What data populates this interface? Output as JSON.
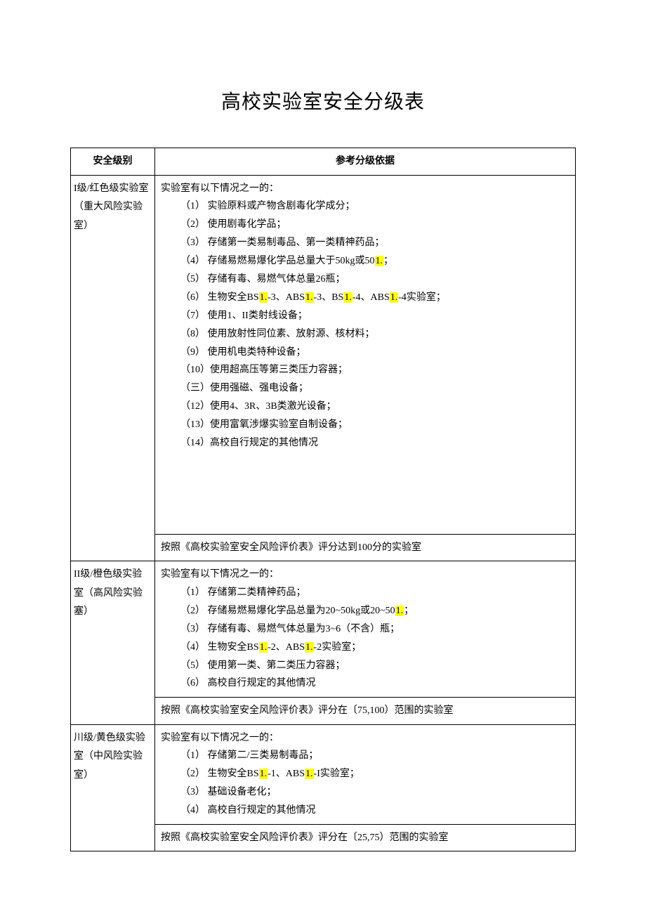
{
  "title": "高校实验室安全分级表",
  "headers": {
    "col1": "安全级别",
    "col2": "参考分级依据"
  },
  "levels": [
    {
      "name": "I级/红色级实验室（重大风险实验室）",
      "intro": "实验室有以下情况之一的：",
      "items": [
        "（1） 实验原料或产物含剧毒化学成分；",
        "（2） 使用剧毒化学品；",
        "（3） 存储第一类易制毒品、第一类精神药品；",
        "（4） 存储易燃易爆化学品总量大于50kg或50|1.|；",
        "（5） 存储有毒、易燃气体总量26瓶；",
        "（6） 生物安全BS|1.|-3、ABS|1.|-3、BS|1.|-4、ABS|1.|-4实验室；",
        "（7） 使用1、II类射线设备；",
        "（8） 使用放射性同位素、放射源、核材料；",
        "（9） 使用机电类特种设备；",
        "（10）使用超高压等第三类压力容器；",
        "（三）使用强磁、强电设备；",
        "（12）使用4、3R、3B类激光设备；",
        "（13）使用富氧涉爆实验室自制设备；",
        "（14）高校自行规定的其他情况"
      ],
      "score": "按照《高校实验室安全风险评价表》评分达到100分的实验室",
      "has_spacer": true
    },
    {
      "name": "II级/橙色级实验室（高风险实验塞）",
      "intro": "实验室有以下情况之一的：",
      "items": [
        "（1） 存储第二类精神药品；",
        "（2） 存储易燃易爆化学品总量为20~50kg或20~50|1.|；",
        "（3） 存储有毒、易燃气体总量为3~6（不含）瓶；",
        "（4） 生物安全BS|1.|-2、ABS|1.|-2实验室；",
        "（5） 使用第一类、第二类压力容器；",
        "（6） 高校自行规定的其他情况"
      ],
      "score": "按照《高校实验室安全风险评价表》评分在〔75,100）范围的实验室",
      "has_spacer": false
    },
    {
      "name": "川级/黄色级实验室（中风险实验室）",
      "intro": "实验室有以下情况之一的：",
      "items": [
        "（1） 存储第二/三类易制毒品；",
        "（2） 生物安全BS|1.|-1、ABS|1.|-I实验室；",
        "（3） 基础设备老化；",
        "（4） 高校自行规定的其他情况"
      ],
      "score": "按照《高校实验室安全风险评价表》评分在〔25,75）范围的实验室",
      "has_spacer": false
    }
  ]
}
